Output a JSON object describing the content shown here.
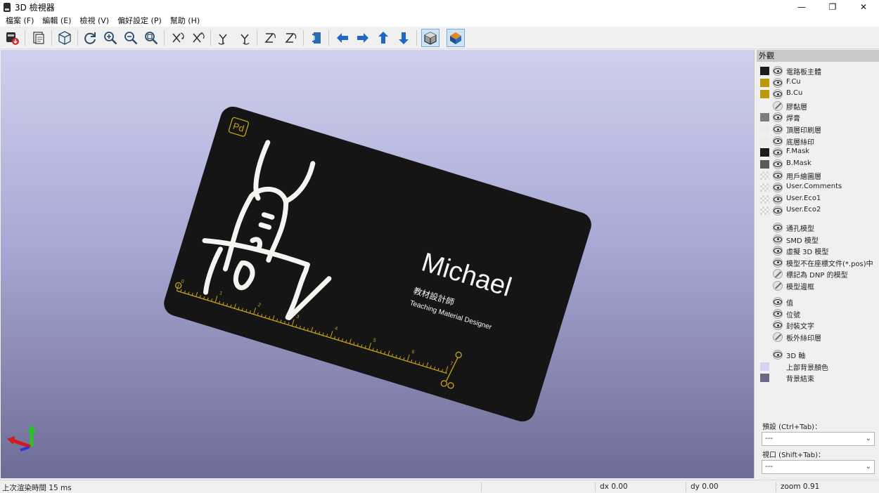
{
  "window": {
    "title": "3D 檢視器",
    "controls": [
      "—",
      "❐",
      "✕"
    ]
  },
  "menu": [
    "檔案 (F)",
    "編輯 (E)",
    "檢視 (V)",
    "偏好設定 (P)",
    "幫助 (H)"
  ],
  "toolbar": {
    "tools": [
      {
        "name": "export-image-icon"
      },
      {
        "name": "copy-to-clipboard-icon"
      },
      {
        "name": "view-3d-icon"
      },
      {
        "name": "reload-icon"
      },
      {
        "name": "zoom-in-icon"
      },
      {
        "name": "zoom-out-icon"
      },
      {
        "name": "zoom-fit-icon"
      },
      {
        "name": "rotate-x-cw-icon"
      },
      {
        "name": "rotate-x-ccw-icon"
      },
      {
        "name": "rotate-y-cw-icon"
      },
      {
        "name": "rotate-y-ccw-icon"
      },
      {
        "name": "rotate-z-cw-icon"
      },
      {
        "name": "rotate-z-ccw-icon"
      },
      {
        "name": "flip-board-icon"
      },
      {
        "name": "pan-left-icon"
      },
      {
        "name": "pan-right-icon"
      },
      {
        "name": "pan-up-icon"
      },
      {
        "name": "pan-down-icon"
      },
      {
        "name": "orthographic-toggle-icon"
      },
      {
        "name": "render-mode-icon"
      }
    ]
  },
  "board": {
    "name": "Michael",
    "title_zh": "教材設計師",
    "title_en": "Teaching Material Designer",
    "logo": "Pd",
    "ruler_marks": [
      "0",
      "1",
      "2",
      "3",
      "4",
      "5",
      "6",
      "7"
    ],
    "colors": {
      "board": "#141414",
      "copper": "#c8a415",
      "silk": "#f4f4f0"
    }
  },
  "panel": {
    "title": "外觀",
    "layers": [
      {
        "label": "電路板主體",
        "swatch": "#1c1c1c",
        "eye": "on"
      },
      {
        "label": "F.Cu",
        "swatch": "#b89a0b",
        "eye": "on"
      },
      {
        "label": "B.Cu",
        "swatch": "#b89a0b",
        "eye": "on"
      },
      {
        "label": "膠黏層",
        "swatch": "",
        "eye": "off"
      },
      {
        "label": "焊膏",
        "swatch": "#7d7d7d",
        "eye": "on"
      },
      {
        "label": "頂層印刷層",
        "swatch": "#ececec",
        "eye": "on"
      },
      {
        "label": "底層絲印",
        "swatch": "#ececec",
        "eye": "on"
      },
      {
        "label": "F.Mask",
        "swatch": "#1c1c1c",
        "eye": "on"
      },
      {
        "label": "B.Mask",
        "swatch": "#5a5a5a",
        "eye": "on"
      },
      {
        "label": "用戶繪圖層",
        "swatch": "checker",
        "eye": "on"
      },
      {
        "label": "User.Comments",
        "swatch": "checker",
        "eye": "on"
      },
      {
        "label": "User.Eco1",
        "swatch": "checker",
        "eye": "on"
      },
      {
        "label": "User.Eco2",
        "swatch": "checker",
        "eye": "on"
      }
    ],
    "models": [
      {
        "label": "通孔模型",
        "eye": "on"
      },
      {
        "label": "SMD 模型",
        "eye": "on"
      },
      {
        "label": "虛擬 3D 模型",
        "eye": "on"
      },
      {
        "label": "模型不在座標文件(*.pos)中",
        "eye": "on"
      },
      {
        "label": "標記為 DNP 的模型",
        "eye": "off"
      },
      {
        "label": "模型邊框",
        "eye": "off"
      }
    ],
    "annotations": [
      {
        "label": "值",
        "eye": "on"
      },
      {
        "label": "位號",
        "eye": "on"
      },
      {
        "label": "封裝文字",
        "eye": "on"
      },
      {
        "label": "板外絲印層",
        "eye": "off"
      }
    ],
    "view": [
      {
        "label": "3D 軸",
        "swatch": "",
        "eye": "on"
      },
      {
        "label": "上部背景顏色",
        "swatch": "#d4d4f0",
        "eye": ""
      },
      {
        "label": "背景結束",
        "swatch": "#6a6a86",
        "eye": ""
      }
    ],
    "preset_label": "預設 (Ctrl+Tab)：",
    "preset_value": "---",
    "viewport_label": "視口 (Shift+Tab)：",
    "viewport_value": "---"
  },
  "status": {
    "render_time": "上次渲染時間 15 ms",
    "dx": "dx 0.00",
    "dy": "dy 0.00",
    "zoom": "zoom 0.91"
  }
}
